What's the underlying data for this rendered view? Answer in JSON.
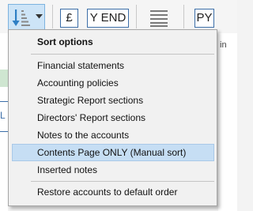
{
  "toolbar": {
    "currency_label": "£",
    "year_end_label": "Y END",
    "py_label": "PY",
    "icons": [
      "sort-order-icon",
      "chevron-down-icon",
      "align-lines-icon"
    ]
  },
  "background": {
    "right_strip_label": "in",
    "left_edge_label": "L"
  },
  "sort_menu": {
    "header": "Sort options",
    "items": [
      {
        "label": "Financial statements"
      },
      {
        "label": "Accounting policies"
      },
      {
        "label": "Strategic Report sections"
      },
      {
        "label": "Directors' Report sections"
      },
      {
        "label": "Notes to the accounts"
      },
      {
        "label": "Contents Page ONLY (Manual sort)",
        "selected": true
      },
      {
        "label": "Inserted notes"
      }
    ],
    "restore_label": "Restore accounts to default order"
  },
  "colors": {
    "accent_border": "#3c6ea8",
    "menu_selected_bg": "#c6def4",
    "toolbar_active_bg": "#cde4f7",
    "sort_icon_blue": "#2f7fc4"
  }
}
